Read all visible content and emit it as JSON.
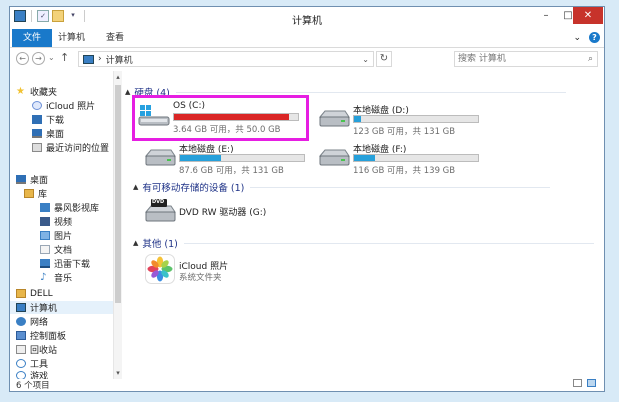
{
  "window": {
    "title": "计算机",
    "controls": {
      "minimize": "–",
      "maximize": "□",
      "close": "✕"
    }
  },
  "ribbon": {
    "tabs": [
      {
        "label": "文件",
        "active": true
      },
      {
        "label": "计算机"
      },
      {
        "label": "查看"
      }
    ],
    "expand_glyph": "⌄",
    "help_glyph": "?"
  },
  "address": {
    "back": "←",
    "forward": "→",
    "up": "↑",
    "breadcrumb_sep": "›",
    "crumb": "计算机",
    "dropdown": "⌄",
    "refresh": "↻",
    "search_placeholder": "搜索 计算机",
    "search_glyph": "⌕"
  },
  "nav_pane": {
    "items": [
      {
        "label": "收藏夹",
        "icon": "star-icon",
        "color": "#f1c232"
      },
      {
        "label": "iCloud 照片",
        "icon": "icloud-icon",
        "color": "#6b8fd6"
      },
      {
        "label": "下载",
        "icon": "download-folder-icon",
        "color": "#2f6fb5"
      },
      {
        "label": "桌面",
        "icon": "desktop-icon",
        "color": "#2f6fb5"
      },
      {
        "label": "最近访问的位置",
        "icon": "recent-places-icon",
        "color": "#8a8a8a"
      },
      {
        "label": "桌面",
        "icon": "desktop-icon",
        "color": "#2f6fb5"
      },
      {
        "label": "库",
        "icon": "library-icon",
        "color": "#e8b64a"
      },
      {
        "label": "暴风影视库",
        "icon": "video-library-icon",
        "color": "#3a7fc4"
      },
      {
        "label": "视频",
        "icon": "video-icon",
        "color": "#3a5a8a"
      },
      {
        "label": "图片",
        "icon": "pictures-icon",
        "color": "#3a7fc4"
      },
      {
        "label": "文档",
        "icon": "documents-icon",
        "color": "#9aa7b5"
      },
      {
        "label": "迅雷下载",
        "icon": "thunder-download-icon",
        "color": "#3a7fc4"
      },
      {
        "label": "音乐",
        "icon": "music-icon",
        "color": "#3a7fc4"
      },
      {
        "label": "DELL",
        "icon": "user-folder-icon",
        "color": "#e8b64a"
      },
      {
        "label": "计算机",
        "icon": "computer-icon",
        "color": "#3a7fc4",
        "selected": true
      },
      {
        "label": "网络",
        "icon": "network-icon",
        "color": "#3a7fc4"
      },
      {
        "label": "控制面板",
        "icon": "control-panel-icon",
        "color": "#3a7fc4"
      },
      {
        "label": "回收站",
        "icon": "recycle-bin-icon",
        "color": "#8a8a8a"
      },
      {
        "label": "工具",
        "icon": "tools-icon",
        "color": "#3a7fc4"
      },
      {
        "label": "游戏",
        "icon": "games-icon",
        "color": "#3a7fc4"
      }
    ],
    "scroll_up": "▴",
    "scroll_down": "▾"
  },
  "groups": {
    "hard_disks": {
      "label": "硬盘 (4)"
    },
    "removable": {
      "label": "有可移动存储的设备 (1)"
    },
    "other": {
      "label": "其他 (1)"
    }
  },
  "drives": [
    {
      "name": "OS (C:)",
      "free_text": "3.64 GB 可用，共 50.0 GB",
      "used_fraction": 0.93,
      "bar_color": "#da2626",
      "icon": "windows-drive-icon",
      "highlighted": true
    },
    {
      "name": "本地磁盘 (D:)",
      "free_text": "123 GB 可用，共 131 GB",
      "used_fraction": 0.06,
      "bar_color": "#26a0da",
      "icon": "hard-drive-icon"
    },
    {
      "name": "本地磁盘 (E:)",
      "free_text": "87.6 GB 可用，共 131 GB",
      "used_fraction": 0.33,
      "bar_color": "#26a0da",
      "icon": "hard-drive-icon"
    },
    {
      "name": "本地磁盘 (F:)",
      "free_text": "116 GB 可用，共 139 GB",
      "used_fraction": 0.17,
      "bar_color": "#26a0da",
      "icon": "hard-drive-icon"
    }
  ],
  "removable_devices": [
    {
      "name": "DVD RW 驱动器 (G:)",
      "icon": "dvd-drive-icon",
      "badge": "DVD"
    }
  ],
  "other_items": [
    {
      "name": "iCloud 照片",
      "subtitle": "系统文件夹",
      "icon": "icloud-photos-icon"
    }
  ],
  "status": {
    "count": "6 个项目"
  },
  "colors": {
    "accent": "#1979ca",
    "group_header": "#1e3287",
    "highlight_box": "#e61ee2",
    "drive_full": "#da2626",
    "drive_normal": "#26a0da"
  }
}
